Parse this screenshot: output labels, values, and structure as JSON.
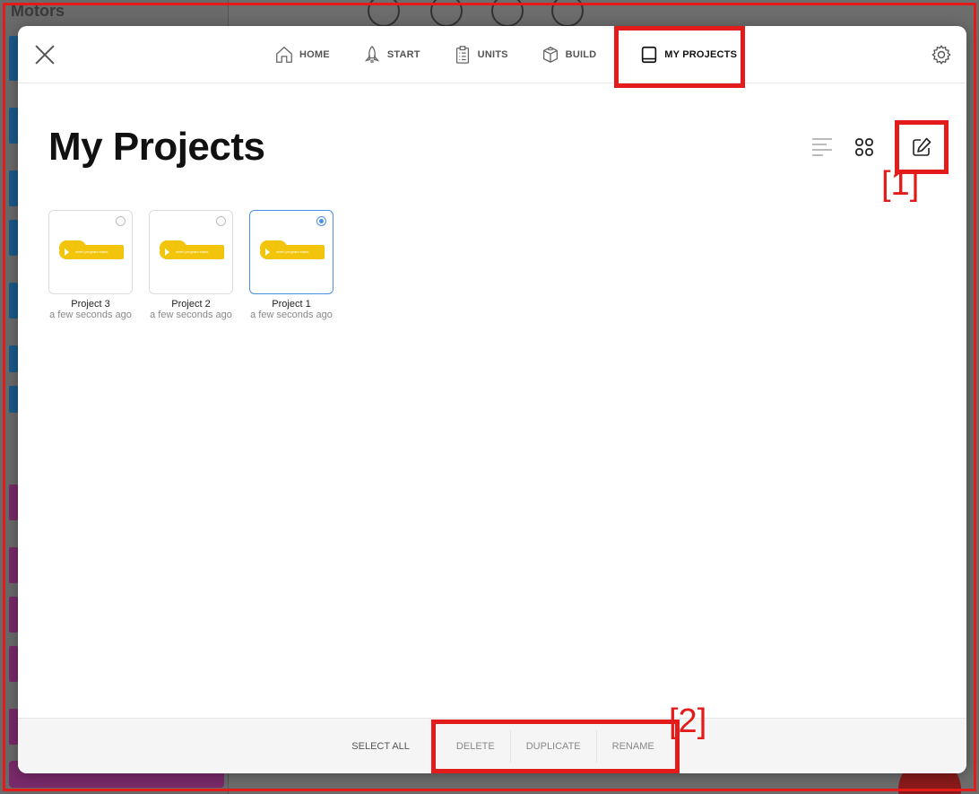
{
  "background": {
    "sidebar_title": "Motors"
  },
  "header": {
    "nav": [
      {
        "label": "HOME",
        "icon": "home-icon"
      },
      {
        "label": "START",
        "icon": "rocket-icon"
      },
      {
        "label": "UNITS",
        "icon": "clipboard-list-icon"
      },
      {
        "label": "BUILD",
        "icon": "cube-icon"
      },
      {
        "label": "MY PROJECTS",
        "icon": "book-icon",
        "active": true
      }
    ]
  },
  "main": {
    "title": "My Projects",
    "projects": [
      {
        "name": "Project 3",
        "time": "a few seconds ago",
        "selected": false,
        "block_text": "when program starts"
      },
      {
        "name": "Project 2",
        "time": "a few seconds ago",
        "selected": false,
        "block_text": "when program starts"
      },
      {
        "name": "Project 1",
        "time": "a few seconds ago",
        "selected": true,
        "block_text": "when program starts"
      }
    ]
  },
  "annotations": {
    "marker_1": "[1]",
    "marker_2": "[2]"
  },
  "footer": {
    "select_all": "SELECT ALL",
    "actions": [
      "DELETE",
      "DUPLICATE",
      "RENAME"
    ]
  },
  "colors": {
    "highlight": "#e31b1b",
    "selection_blue": "#4a8fe0",
    "block_yellow": "#f2c40b"
  }
}
